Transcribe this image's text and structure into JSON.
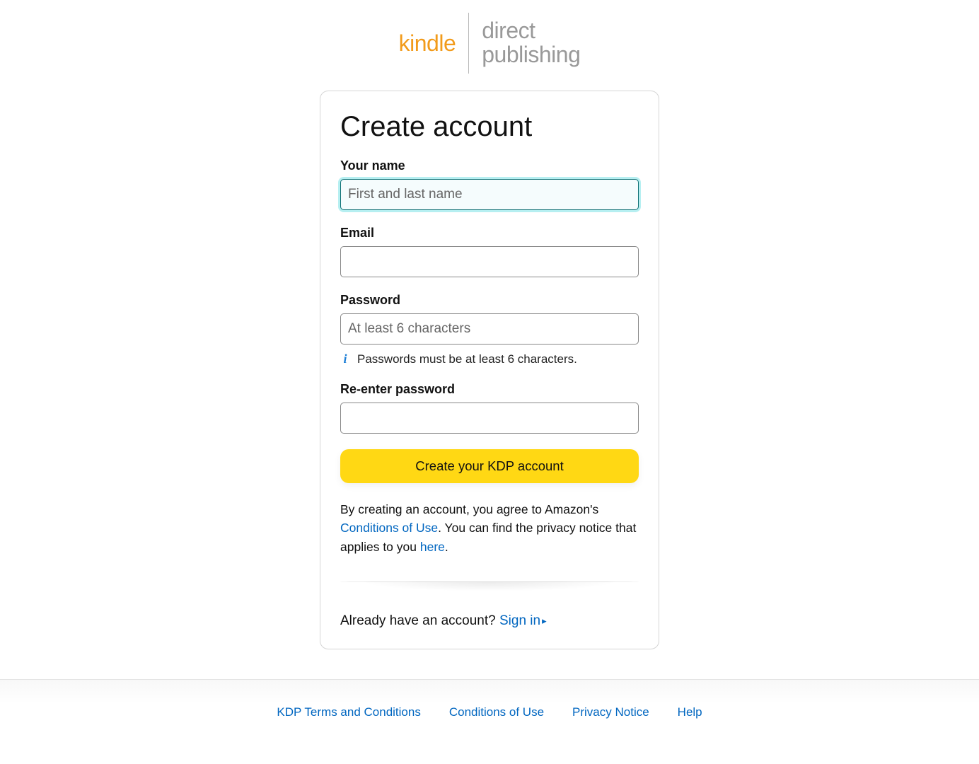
{
  "logo": {
    "kindle": "kindle",
    "direct": "direct",
    "publishing": "publishing"
  },
  "form": {
    "title": "Create account",
    "name": {
      "label": "Your name",
      "placeholder": "First and last name",
      "value": ""
    },
    "email": {
      "label": "Email",
      "value": ""
    },
    "password": {
      "label": "Password",
      "placeholder": "At least 6 characters",
      "value": "",
      "hint": "Passwords must be at least 6 characters."
    },
    "password2": {
      "label": "Re-enter password",
      "value": ""
    },
    "submit": "Create your KDP account",
    "legal": {
      "pre": "By creating an account, you agree to Amazon's ",
      "conditions": "Conditions of Use",
      "mid": ". You can find the privacy notice that applies to you ",
      "here": "here",
      "post": "."
    },
    "signin": {
      "prompt": "Already have an account? ",
      "link": "Sign in"
    }
  },
  "footer": {
    "links": [
      "KDP Terms and Conditions",
      "Conditions of Use",
      "Privacy Notice",
      "Help"
    ]
  }
}
